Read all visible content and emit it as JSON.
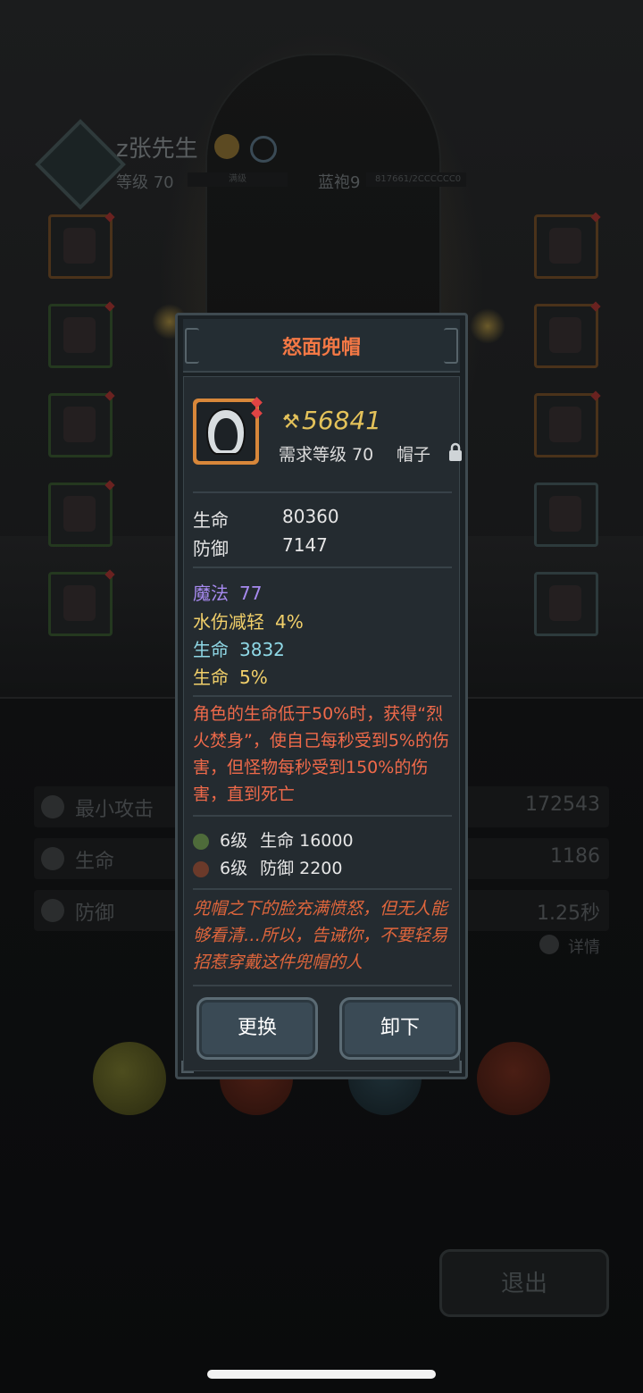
{
  "hero": {
    "name": "z张先生",
    "level_text": "等级 70",
    "level_bar_text": "满级",
    "rank_text": "蓝袍9",
    "exp_text": "817661/2CCCCCC0"
  },
  "background_stats": [
    {
      "label": "最小攻击",
      "value": "172543"
    },
    {
      "label": "生命",
      "value": "1186"
    },
    {
      "label": "防御",
      "value": "1.25秒"
    }
  ],
  "detail_link": "详情",
  "exit_button": "退出",
  "panel": {
    "title": "怒面兜帽",
    "power": "56841",
    "required_level": "需求等级 70",
    "slot_type": "帽子",
    "base_attrs": [
      {
        "label": "生命",
        "value": "80360"
      },
      {
        "label": "防御",
        "value": "7147"
      }
    ],
    "bonus_attrs": [
      {
        "label": "魔法",
        "value": "77",
        "color": "#a78af0"
      },
      {
        "label": "水伤减轻",
        "value": "4%",
        "color": "#f2d06a"
      },
      {
        "label": "生命",
        "value": "3832",
        "color": "#8fd8e6"
      },
      {
        "label": "生命",
        "value": "5%",
        "color": "#f2d06a"
      }
    ],
    "skill_description": "角色的生命低于50%时，获得“烈火焚身”，使自己每秒受到5%的伤害，但怪物每秒受到150%的伤害，直到死亡",
    "set_bonuses": [
      {
        "level": "6级",
        "text": "生命 16000"
      },
      {
        "level": "6级",
        "text": "防御 2200"
      }
    ],
    "flavor_text": "兜帽之下的脸充满愤怒，但无人能够看清…所以，告诫你，不要轻易招惹穿戴这件兜帽的人",
    "buttons": {
      "change": "更换",
      "unequip": "卸下"
    }
  },
  "colors": {
    "title": "#f47845",
    "power": "#e4c25a",
    "skill_text": "#f06a4a",
    "flavor_text": "#e0663c",
    "item_border": "#d8873a"
  }
}
